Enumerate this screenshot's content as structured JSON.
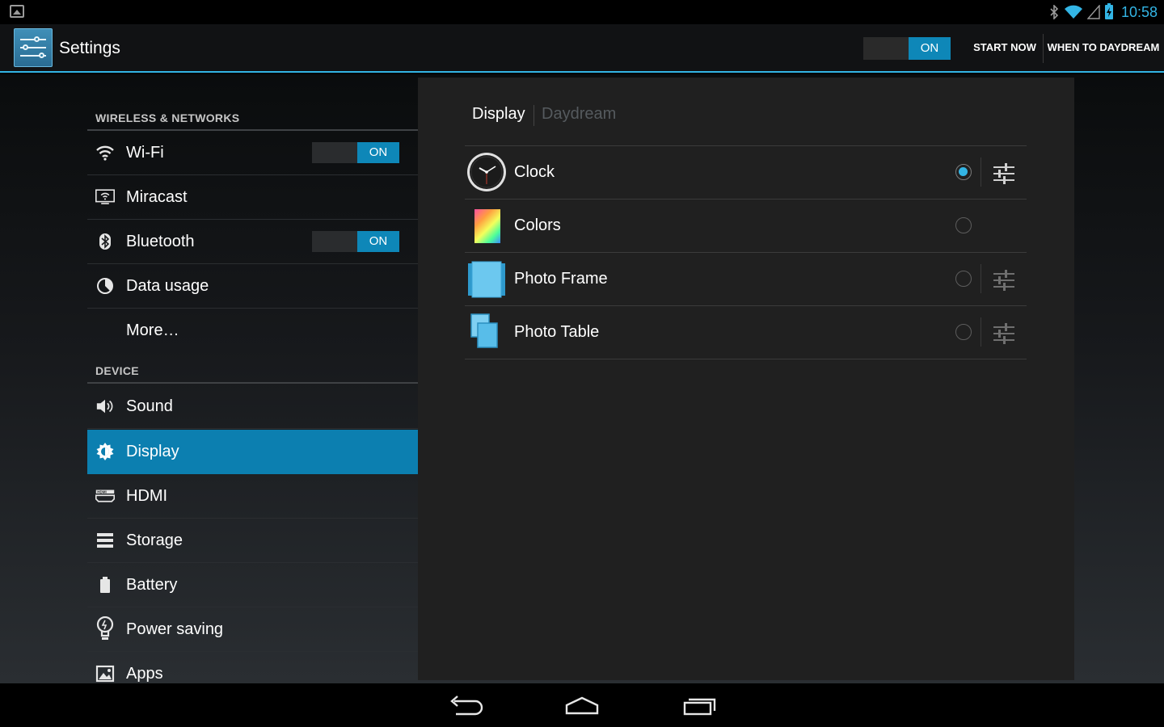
{
  "status_bar": {
    "time": "10:58",
    "icons": [
      "gallery-icon",
      "bluetooth-icon",
      "wifi-icon",
      "signal-icon",
      "battery-charging-icon"
    ]
  },
  "action_bar": {
    "app_icon": "settings-sliders-icon",
    "title": "Settings",
    "master_toggle": "ON",
    "start_now": "START NOW",
    "when_to_daydream": "WHEN TO DAYDREAM"
  },
  "sidebar": {
    "sections": {
      "wireless": "WIRELESS & NETWORKS",
      "device": "DEVICE"
    },
    "items": [
      {
        "label": "Wi-Fi",
        "icon": "wifi-icon",
        "toggle": "ON"
      },
      {
        "label": "Miracast",
        "icon": "miracast-icon"
      },
      {
        "label": "Bluetooth",
        "icon": "bluetooth-icon",
        "toggle": "ON"
      },
      {
        "label": "Data usage",
        "icon": "data-usage-icon"
      },
      {
        "label": "More…"
      },
      {
        "label": "Sound",
        "icon": "sound-icon"
      },
      {
        "label": "Display",
        "icon": "display-brightness-icon",
        "selected": true
      },
      {
        "label": "HDMI",
        "icon": "hdmi-icon"
      },
      {
        "label": "Storage",
        "icon": "storage-icon"
      },
      {
        "label": "Battery",
        "icon": "battery-icon"
      },
      {
        "label": "Power saving",
        "icon": "lightbulb-icon"
      },
      {
        "label": "Apps",
        "icon": "apps-icon"
      }
    ]
  },
  "content": {
    "breadcrumb": {
      "parent": "Display",
      "current": "Daydream"
    },
    "dreams": [
      {
        "label": "Clock",
        "icon": "clock-icon",
        "selected": true,
        "has_settings": true
      },
      {
        "label": "Colors",
        "icon": "colors-icon",
        "selected": false,
        "has_settings": false
      },
      {
        "label": "Photo Frame",
        "icon": "photo-frame-icon",
        "selected": false,
        "has_settings": true
      },
      {
        "label": "Photo Table",
        "icon": "photo-table-icon",
        "selected": false,
        "has_settings": true
      }
    ]
  },
  "nav_bar": {
    "buttons": [
      "back-icon",
      "home-icon",
      "recent-apps-icon"
    ]
  },
  "colors": {
    "accent": "#33b5e5",
    "selected_row": "#0c7fb0",
    "toggle_on": "#0e87b8",
    "panel": "#202020"
  }
}
